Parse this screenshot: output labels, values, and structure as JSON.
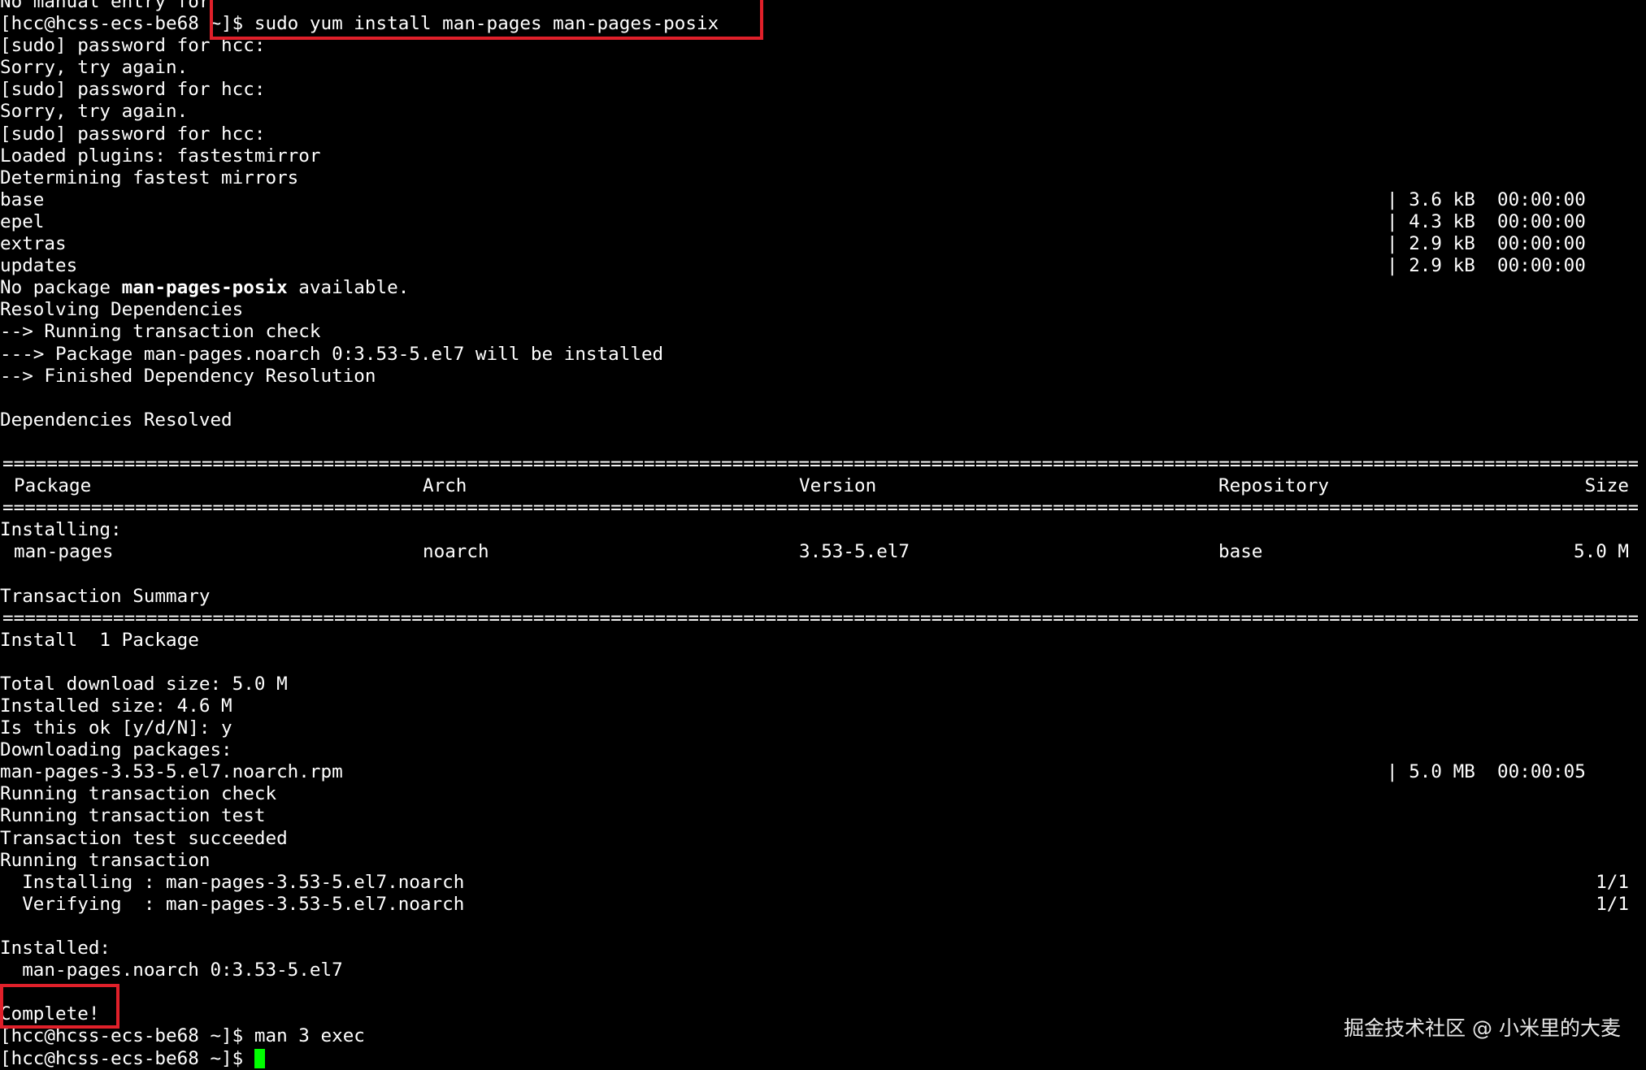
{
  "terminal": {
    "top_fragment": "No manual entry for",
    "prompt1": "[hcc@hcss-ecs-be68 ~]$ ",
    "command1": "sudo yum install man-pages man-pages-posix",
    "sudo_prompt": "[sudo] password for hcc:",
    "sorry": "Sorry, try again.",
    "loaded_plugins": "Loaded plugins: fastestmirror",
    "determining": "Determining fastest mirrors",
    "repos": [
      {
        "name": "base",
        "size": "| 3.6 kB  00:00:00"
      },
      {
        "name": "epel",
        "size": "| 4.3 kB  00:00:00"
      },
      {
        "name": "extras",
        "size": "| 2.9 kB  00:00:00"
      },
      {
        "name": "updates",
        "size": "| 2.9 kB  00:00:00"
      }
    ],
    "no_package_prefix": "No package ",
    "no_package_name": "man-pages-posix",
    "no_package_suffix": " available.",
    "resolving": "Resolving Dependencies",
    "running_check": "--> Running transaction check",
    "package_line": "---> Package man-pages.noarch 0:3.53-5.el7 will be installed",
    "finished_dep": "--> Finished Dependency Resolution",
    "deps_resolved": "Dependencies Resolved",
    "separator": "==================================================================================================================================================================================================================",
    "table": {
      "headers": {
        "package": "Package",
        "arch": "Arch",
        "version": "Version",
        "repository": "Repository",
        "size": "Size"
      },
      "section": "Installing:",
      "row": {
        "package": "man-pages",
        "arch": "noarch",
        "version": "3.53-5.el7",
        "repository": "base",
        "size": "5.0 M"
      }
    },
    "transaction_summary": "Transaction Summary",
    "install_count": "Install  1 Package",
    "total_download": "Total download size: 5.0 M",
    "installed_size": "Installed size: 4.6 M",
    "is_ok": "Is this ok [y/d/N]: y",
    "downloading": "Downloading packages:",
    "rpm_name": "man-pages-3.53-5.el7.noarch.rpm",
    "rpm_size": "| 5.0 MB  00:00:05",
    "running_tx_check": "Running transaction check",
    "running_tx_test": "Running transaction test",
    "tx_test_ok": "Transaction test succeeded",
    "running_tx": "Running transaction",
    "installing_step": "  Installing : man-pages-3.53-5.el7.noarch",
    "installing_count": "1/1",
    "verifying_step": "  Verifying  : man-pages-3.53-5.el7.noarch",
    "verifying_count": "1/1",
    "installed_label": "Installed:",
    "installed_pkg": "  man-pages.noarch 0:3.53-5.el7",
    "complete": "Complete!",
    "prompt2": "[hcc@hcss-ecs-be68 ~]$ ",
    "command2": "man 3 exec",
    "prompt3": "[hcc@hcss-ecs-be68 ~]$ "
  },
  "watermark": "掘金技术社区 @ 小米里的大麦",
  "colors": {
    "background": "#000000",
    "text": "#ffffff",
    "cursor": "#00ff00",
    "highlight": "#e0202a"
  }
}
